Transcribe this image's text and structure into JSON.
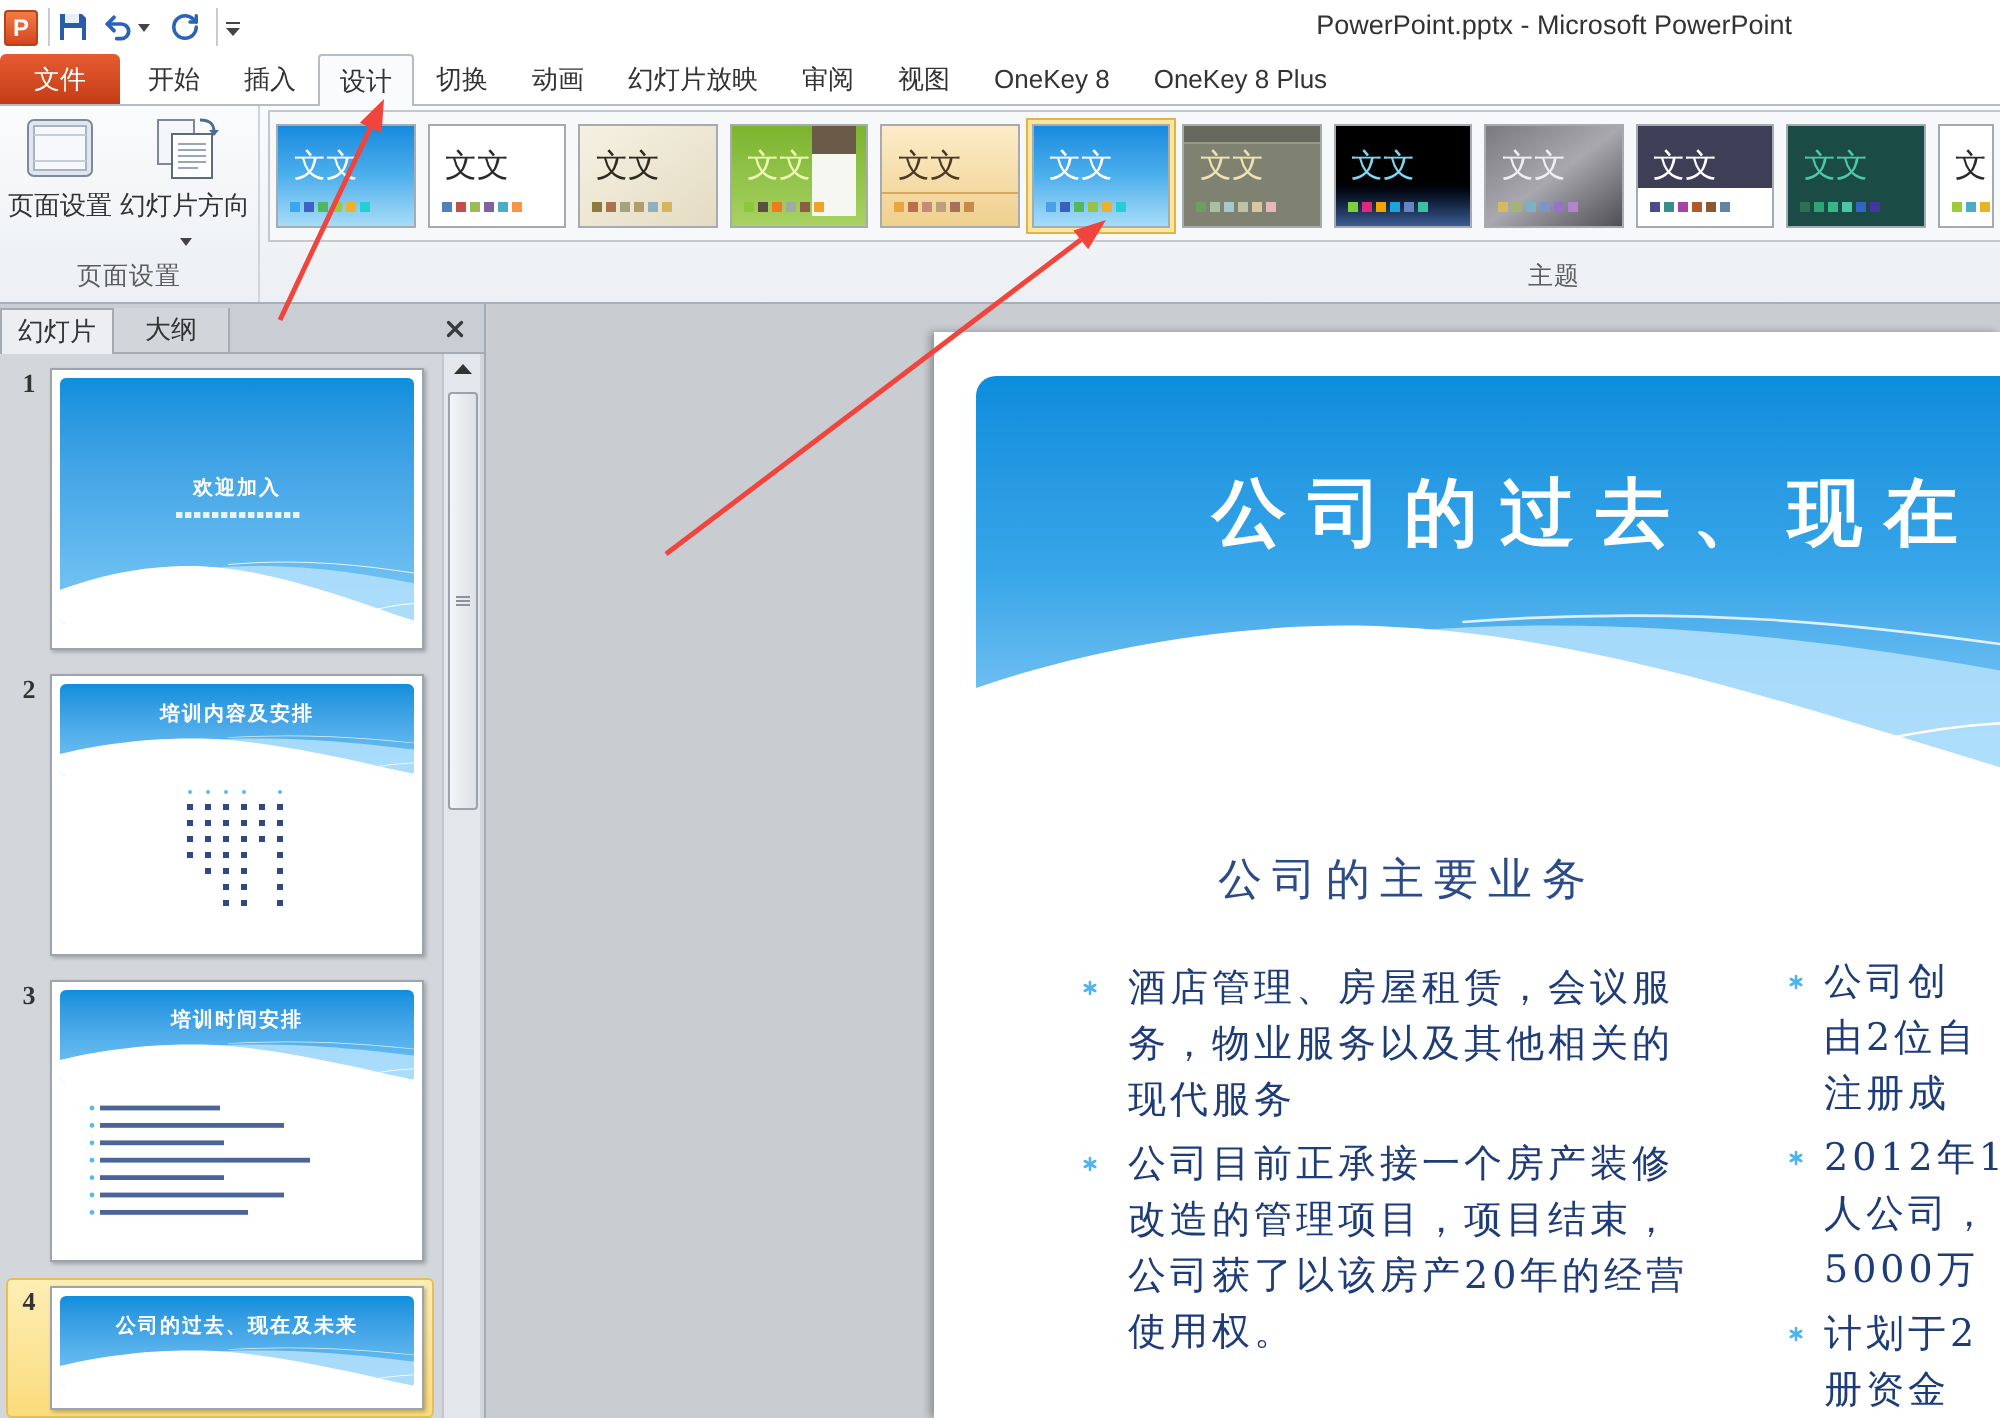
{
  "title_bar": {
    "app_icon": "P",
    "title": "PowerPoint.pptx - Microsoft PowerPoint"
  },
  "tabs": [
    {
      "label": "文件",
      "kind": "file",
      "selected": false
    },
    {
      "label": "开始",
      "kind": "tab",
      "selected": false
    },
    {
      "label": "插入",
      "kind": "tab",
      "selected": false
    },
    {
      "label": "设计",
      "kind": "tab",
      "selected": true
    },
    {
      "label": "切换",
      "kind": "tab",
      "selected": false
    },
    {
      "label": "动画",
      "kind": "tab",
      "selected": false
    },
    {
      "label": "幻灯片放映",
      "kind": "tab",
      "selected": false
    },
    {
      "label": "审阅",
      "kind": "tab",
      "selected": false
    },
    {
      "label": "视图",
      "kind": "tab",
      "selected": false
    },
    {
      "label": "OneKey 8",
      "kind": "tab",
      "selected": false
    },
    {
      "label": "OneKey 8 Plus",
      "kind": "tab",
      "selected": false
    }
  ],
  "ribbon": {
    "page_setup": {
      "label": "页面设置",
      "buttons": [
        {
          "label": "页面设置",
          "kind": "page",
          "dropdown": false
        },
        {
          "label": "幻灯片方向",
          "kind": "orientation",
          "dropdown": true
        }
      ]
    },
    "themes": {
      "label": "主题",
      "items": [
        {
          "label": "文文",
          "kind": "sky",
          "selected": false,
          "swatches": [
            {
              "color": "#3aa8f0"
            },
            {
              "color": "#3b62c4"
            },
            {
              "color": "#4cb860"
            },
            {
              "color": "#9ccc3c"
            },
            {
              "color": "#f0b02c"
            },
            {
              "color": "#22d0d4"
            }
          ]
        },
        {
          "label": "文文",
          "kind": "plain",
          "selected": false,
          "swatches": [
            {
              "color": "#4f81bd"
            },
            {
              "color": "#c0504d"
            },
            {
              "color": "#9bbb59"
            },
            {
              "color": "#8064a2"
            },
            {
              "color": "#4bacc6"
            },
            {
              "color": "#f79646"
            }
          ]
        },
        {
          "label": "文文",
          "kind": "cream",
          "selected": false,
          "swatches": [
            {
              "color": "#8c7b3c"
            },
            {
              "color": "#a8744e"
            },
            {
              "color": "#a4a47a"
            },
            {
              "color": "#b39b6e"
            },
            {
              "color": "#8fb0bc"
            },
            {
              "color": "#d6b45c"
            }
          ]
        },
        {
          "label": "文文",
          "kind": "green",
          "selected": false,
          "swatches": [
            {
              "color": "#8cc83c"
            },
            {
              "color": "#5c4e3e"
            },
            {
              "color": "#f07a1c"
            },
            {
              "color": "#a2a8a2"
            },
            {
              "color": "#8a5e3e"
            },
            {
              "color": "#eea428"
            }
          ]
        },
        {
          "label": "文文",
          "kind": "tan",
          "selected": false,
          "swatches": [
            {
              "color": "#e9a640"
            },
            {
              "color": "#b8704c"
            },
            {
              "color": "#c48c78"
            },
            {
              "color": "#bca07c"
            },
            {
              "color": "#a8705c"
            },
            {
              "color": "#c88a48"
            }
          ]
        },
        {
          "label": "文文",
          "kind": "sky",
          "selected": true,
          "swatches": [
            {
              "color": "#4aa0e8"
            },
            {
              "color": "#3c5ec0"
            },
            {
              "color": "#56b85c"
            },
            {
              "color": "#94c442"
            },
            {
              "color": "#eab030"
            },
            {
              "color": "#26ccd6"
            }
          ]
        },
        {
          "label": "文文",
          "kind": "olive",
          "selected": false,
          "swatches": [
            {
              "color": "#6e9e64"
            },
            {
              "color": "#a8c0a0"
            },
            {
              "color": "#a6c8d0"
            },
            {
              "color": "#c0c2a8"
            },
            {
              "color": "#d8c8a0"
            },
            {
              "color": "#e8b8b8"
            }
          ]
        },
        {
          "label": "文文",
          "kind": "black",
          "selected": false,
          "swatches": [
            {
              "color": "#7cd040"
            },
            {
              "color": "#e0287c"
            },
            {
              "color": "#f4a400"
            },
            {
              "color": "#1ca4dc"
            },
            {
              "color": "#6484c4"
            },
            {
              "color": "#3cc0a4"
            }
          ]
        },
        {
          "label": "文文",
          "kind": "gray",
          "selected": false,
          "swatches": [
            {
              "color": "#d4bc5c"
            },
            {
              "color": "#a4b474"
            },
            {
              "color": "#7cb0c4"
            },
            {
              "color": "#7c94c8"
            },
            {
              "color": "#9474c8"
            },
            {
              "color": "#b484d0"
            }
          ]
        },
        {
          "label": "文文",
          "kind": "slate",
          "selected": false,
          "swatches": [
            {
              "color": "#4c4c8c"
            },
            {
              "color": "#3c8c8c"
            },
            {
              "color": "#a444a4"
            },
            {
              "color": "#b4582c"
            },
            {
              "color": "#8c5834"
            },
            {
              "color": "#6484a4"
            }
          ]
        },
        {
          "label": "文文",
          "kind": "teal",
          "selected": false,
          "swatches": [
            {
              "color": "#2e6e54"
            },
            {
              "color": "#2ea474"
            },
            {
              "color": "#34b888"
            },
            {
              "color": "#4cc4a8"
            },
            {
              "color": "#3464c4"
            },
            {
              "color": "#4434a4"
            }
          ]
        },
        {
          "label": "文",
          "kind": "plain",
          "selected": false,
          "swatches": [
            {
              "color": "#9ccc3c"
            },
            {
              "color": "#4bacc6"
            },
            {
              "color": "#e4b424"
            }
          ]
        }
      ]
    }
  },
  "slide_pane": {
    "tabs": [
      {
        "label": "幻灯片",
        "selected": true
      },
      {
        "label": "大纲",
        "selected": false
      }
    ],
    "slides": [
      {
        "number": "1",
        "title": "欢迎加入",
        "kind": "title",
        "selected": false
      },
      {
        "number": "2",
        "title": "培训内容及安排",
        "kind": "columns",
        "selected": false
      },
      {
        "number": "3",
        "title": "培训时间安排",
        "kind": "bullets",
        "selected": false
      },
      {
        "number": "4",
        "title": "公司的过去、现在及未来",
        "kind": "heading",
        "selected": true
      }
    ]
  },
  "slide": {
    "title": "公司的过去、现在",
    "subtitle": "公司的主要业务",
    "columns": [
      {
        "bullets": [
          {
            "text": "酒店管理、房屋租赁，会议服务，物业服务以及其他相关的现代服务"
          },
          {
            "text": "公司目前正承接一个房产装修改造的管理项目，项目结束，公司获了以该房产20年的经营使用权。"
          }
        ]
      },
      {
        "bullets": [
          {
            "lines": [
              "公司创",
              "由2位自",
              "注册成"
            ]
          },
          {
            "lines": [
              "2012年1",
              "人公司，",
              "5000万"
            ]
          },
          {
            "lines": [
              "计划于2",
              "册资金"
            ]
          }
        ]
      }
    ]
  }
}
